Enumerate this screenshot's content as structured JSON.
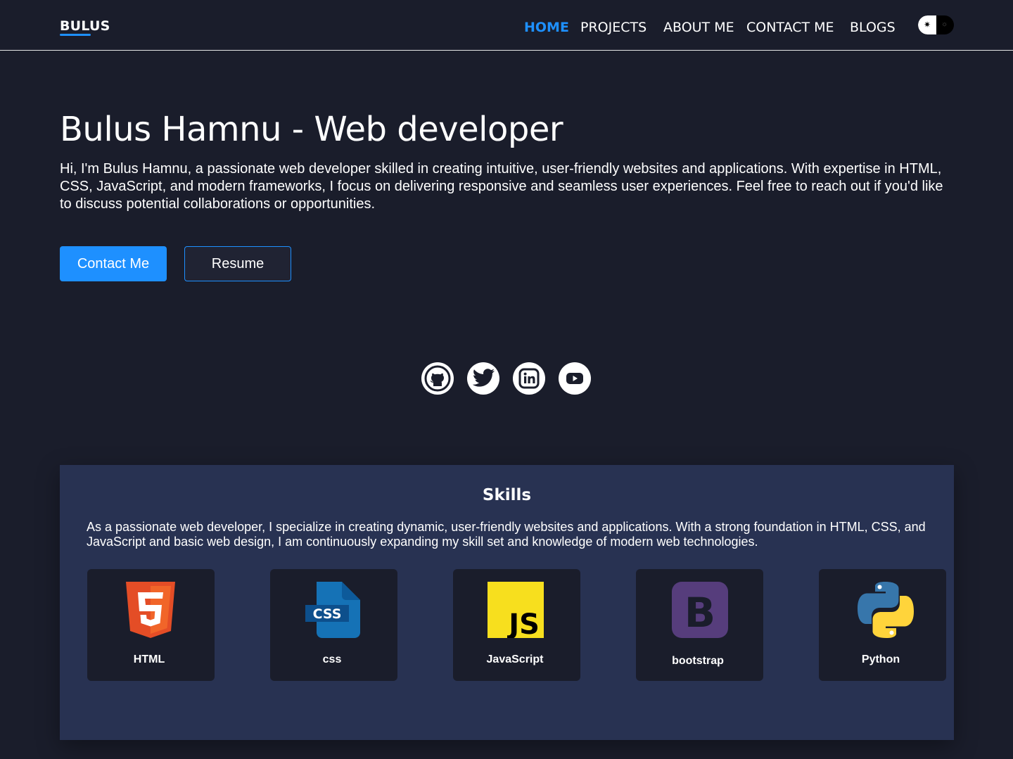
{
  "navbar": {
    "logo": "BULUS",
    "links": [
      "HOME",
      "PROJECTS",
      "ABOUT ME",
      "CONTACT ME",
      "BLOGS"
    ],
    "active_link": "HOME",
    "theme_toggle": {
      "light_icon": "sun-icon",
      "dark_icon": "moon-icon"
    }
  },
  "hero": {
    "title": "Bulus Hamnu - Web developer",
    "description": "Hi, I'm Bulus Hamnu, a passionate web developer skilled in creating intuitive, user-friendly websites and applications. With expertise in HTML, CSS, JavaScript, and modern frameworks, I focus on delivering responsive and seamless user experiences. Feel free to reach out if you'd like to discuss potential collaborations or opportunities.",
    "contact_button": "Contact Me",
    "resume_button": "Resume"
  },
  "socials": [
    {
      "name": "github",
      "icon": "github-icon"
    },
    {
      "name": "twitter",
      "icon": "twitter-icon"
    },
    {
      "name": "linkedin",
      "icon": "linkedin-icon"
    },
    {
      "name": "youtube",
      "icon": "youtube-icon"
    }
  ],
  "skills": {
    "title": "Skills",
    "description": "As a passionate web developer, I specialize in creating dynamic, user-friendly websites and applications. With a strong foundation in HTML, CSS, and JavaScript and basic web design, I am continuously expanding my skill set and knowledge of modern web technologies.",
    "items": [
      {
        "label": "HTML",
        "icon": "html5-icon",
        "color": "#e44d26"
      },
      {
        "label": "css",
        "icon": "css3-icon",
        "color": "#1572b6"
      },
      {
        "label": "JavaScript",
        "icon": "javascript-icon",
        "color": "#f7df1e"
      },
      {
        "label": "bootstrap",
        "icon": "bootstrap-icon",
        "color": "#563d7c"
      },
      {
        "label": "Python",
        "icon": "python-icon",
        "color": "#3776ab"
      }
    ]
  },
  "colors": {
    "background": "#1a1d2b",
    "accent": "#1e90ff",
    "skills_panel": "#283252"
  }
}
